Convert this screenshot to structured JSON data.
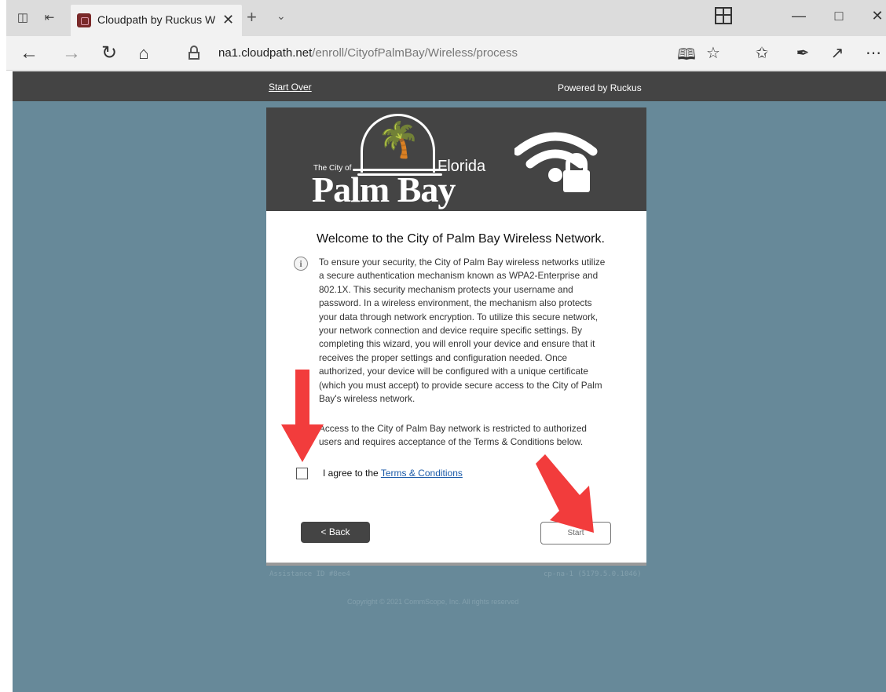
{
  "browser": {
    "tab_title": "Cloudpath by Ruckus W",
    "url_host": "na1.cloudpath.net",
    "url_path": "/enroll/CityofPalmBay/Wireless/process"
  },
  "topbar": {
    "start_over": "Start Over",
    "powered_by": "Powered by Ruckus"
  },
  "banner": {
    "the_city_of": "The City of",
    "florida": "Florida",
    "palm_bay": "Palm Bay"
  },
  "content": {
    "welcome": "Welcome to the City of Palm Bay Wireless Network.",
    "paragraph1": "To ensure your security, the City of Palm Bay wireless networks utilize a secure authentication mechanism known as WPA2-Enterprise and 802.1X. This security mechanism protects your username and password. In a wireless environment, the mechanism also protects your data through network encryption. To utilize this secure network, your network connection and device require specific settings. By completing this wizard, you will enroll your device and ensure that it receives the proper settings and configuration needed. Once authorized, your device will be configured with a unique certificate (which you must accept) to provide secure access to the City of Palm Bay's wireless network.",
    "paragraph2": "Access to the City of Palm Bay network is restricted to authorized users and requires acceptance of the Terms & Conditions below.",
    "agree_prefix": "I agree to the ",
    "terms_link": "Terms & Conditions",
    "back_label": "< Back",
    "start_label": "Start"
  },
  "footer": {
    "assistance_id": "Assistance ID #8ee4",
    "version": "cp-na-1 (5179.5.0.1046)",
    "copyright": "Copyright © 2021 CommScope, Inc. All rights reserved"
  },
  "icons": {
    "annotation_arrow_color": "#f23c3c"
  }
}
